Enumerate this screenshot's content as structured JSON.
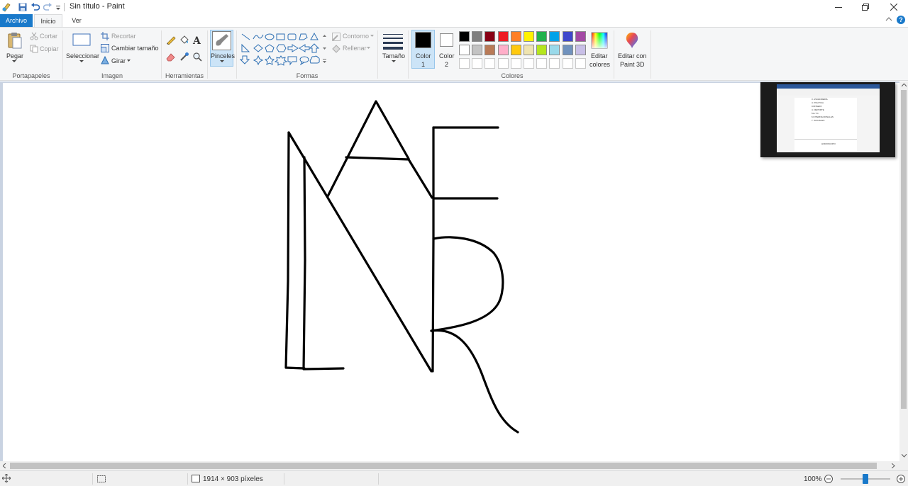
{
  "window": {
    "title": "Sin título - Paint",
    "minimize": "minimize-icon",
    "maximize": "restore-icon",
    "close": "close-icon"
  },
  "tabs": {
    "file": "Archivo",
    "home": "Inicio",
    "view": "Ver",
    "help": "?"
  },
  "ribbon": {
    "clipboard": {
      "label": "Portapapeles",
      "paste": "Pegar",
      "cut": "Cortar",
      "copy": "Copiar"
    },
    "image": {
      "label": "Imagen",
      "select": "Seleccionar",
      "crop": "Recortar",
      "resize": "Cambiar tamaño",
      "rotate": "Girar"
    },
    "tools": {
      "label": "Herramientas",
      "brushes": "Pinceles"
    },
    "shapes": {
      "label": "Formas",
      "outline": "Contorno",
      "fill": "Rellenar"
    },
    "size": {
      "label": "Tamaño"
    },
    "colors": {
      "label": "Colores",
      "color1": "Color",
      "color1_num": "1",
      "color2": "Color",
      "color2_num": "2",
      "color1_value": "#000000",
      "color2_value": "#ffffff",
      "edit": "Editar",
      "edit2": "colores",
      "palette_row1": [
        "#000000",
        "#7f7f7f",
        "#880015",
        "#ed1c24",
        "#ff7f27",
        "#fff200",
        "#22b14c",
        "#00a2e8",
        "#3f48cc",
        "#a349a4"
      ],
      "palette_row2": [
        "#ffffff",
        "#c3c3c3",
        "#b97a57",
        "#ffaec9",
        "#ffc90e",
        "#efe4b0",
        "#b5e61d",
        "#99d9ea",
        "#7092be",
        "#c8bfe7"
      ]
    },
    "paint3d": {
      "line1": "Editar con",
      "line2": "Paint 3D"
    }
  },
  "preview": {
    "lines": [
      "3. ASCENDERIA",
      "4. POLITICA",
      "CONSEJO",
      "4. DEPORTE",
      "5.E.T.C.",
      "6.INTERNACIONALES",
      "7. SOCIALES",
      "HOROSCOPO"
    ]
  },
  "status": {
    "dimensions": "1914 × 903 píxeles",
    "zoom": "100%",
    "zoom_fraction": 0.5
  }
}
